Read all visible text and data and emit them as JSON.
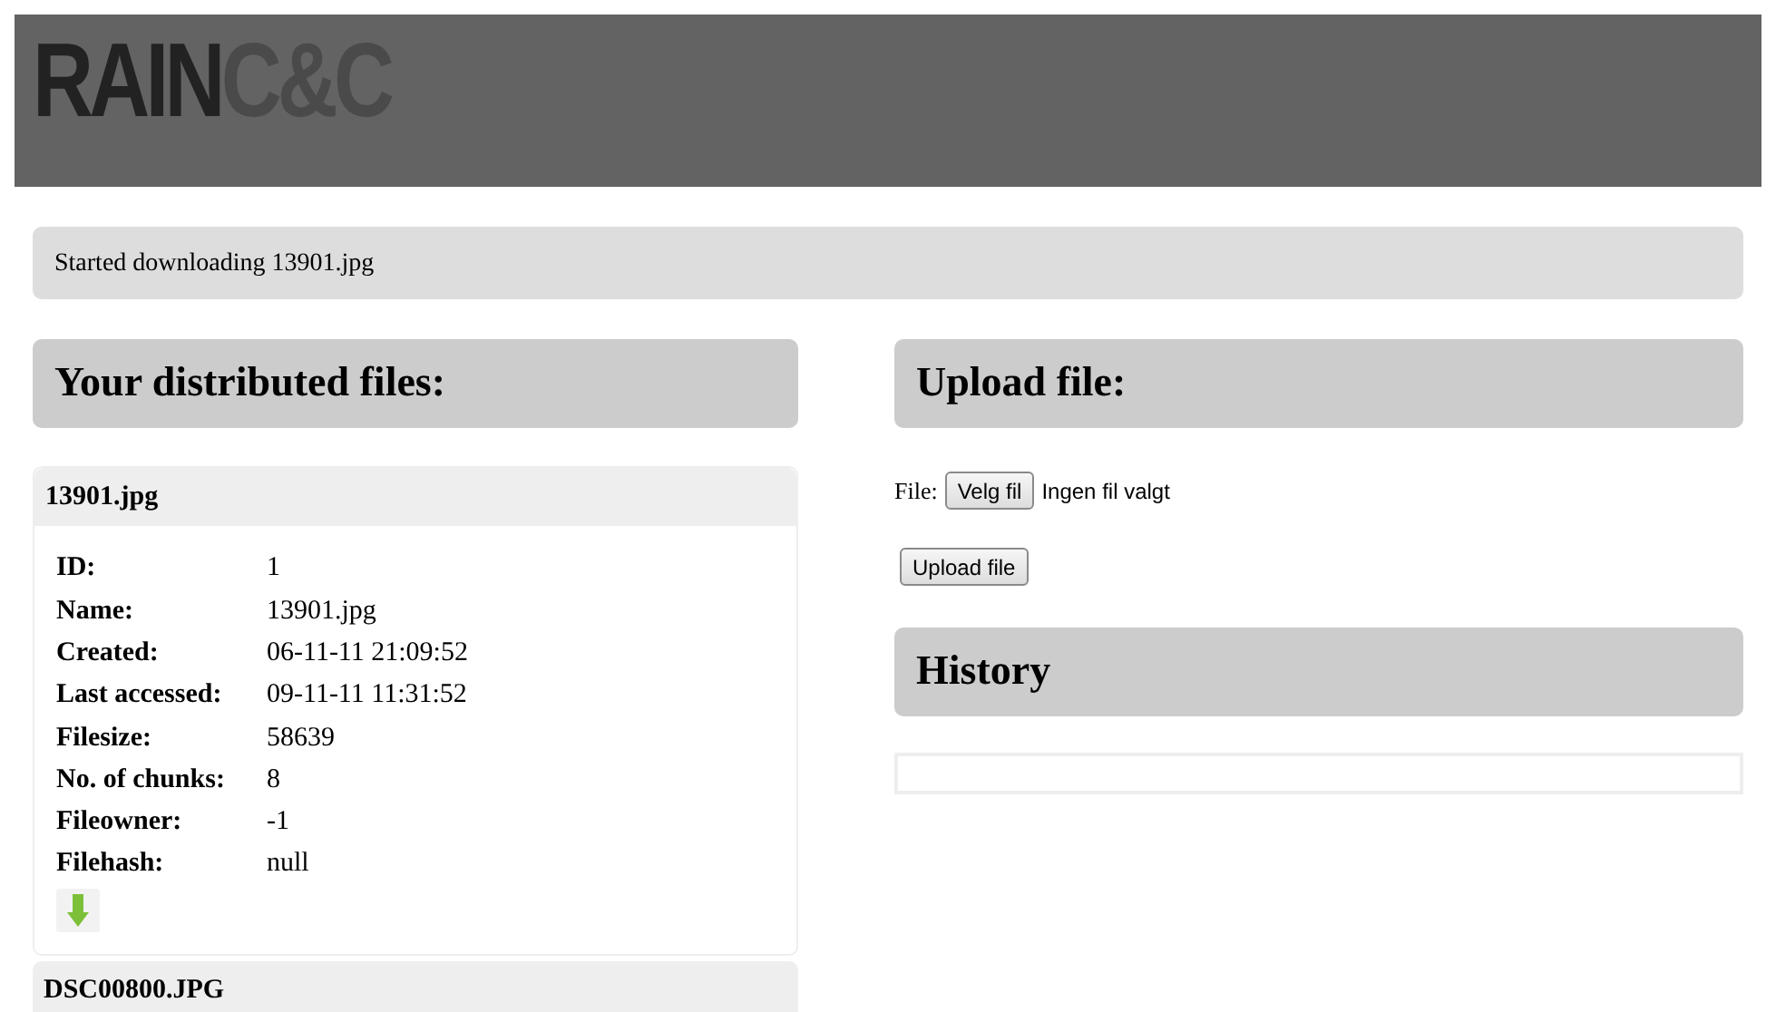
{
  "logo": {
    "part_1": "RAIN",
    "part_2": "C&C"
  },
  "message": "Started downloading 13901.jpg",
  "files_section": {
    "title": "Your distributed files:",
    "files": [
      {
        "name": "13901.jpg",
        "expanded": true,
        "details": [
          {
            "label": "ID:",
            "value": "1"
          },
          {
            "label": "Name:",
            "value": "13901.jpg"
          },
          {
            "label": "Created:",
            "value": "06-11-11 21:09:52"
          },
          {
            "label": "Last accessed:",
            "value": "09-11-11 11:31:52"
          },
          {
            "label": "Filesize:",
            "value": "58639"
          },
          {
            "label": "No. of chunks:",
            "value": "8"
          },
          {
            "label": "Fileowner:",
            "value": "-1"
          },
          {
            "label": "Filehash:",
            "value": "null"
          }
        ]
      },
      {
        "name": "DSC00800.JPG",
        "expanded": false
      }
    ]
  },
  "upload_section": {
    "title": "Upload file:",
    "file_label": "File:",
    "choose_button": "Velg fil",
    "no_file_text": "Ingen fil valgt",
    "upload_button": "Upload file"
  },
  "history_section": {
    "title": "History"
  }
}
